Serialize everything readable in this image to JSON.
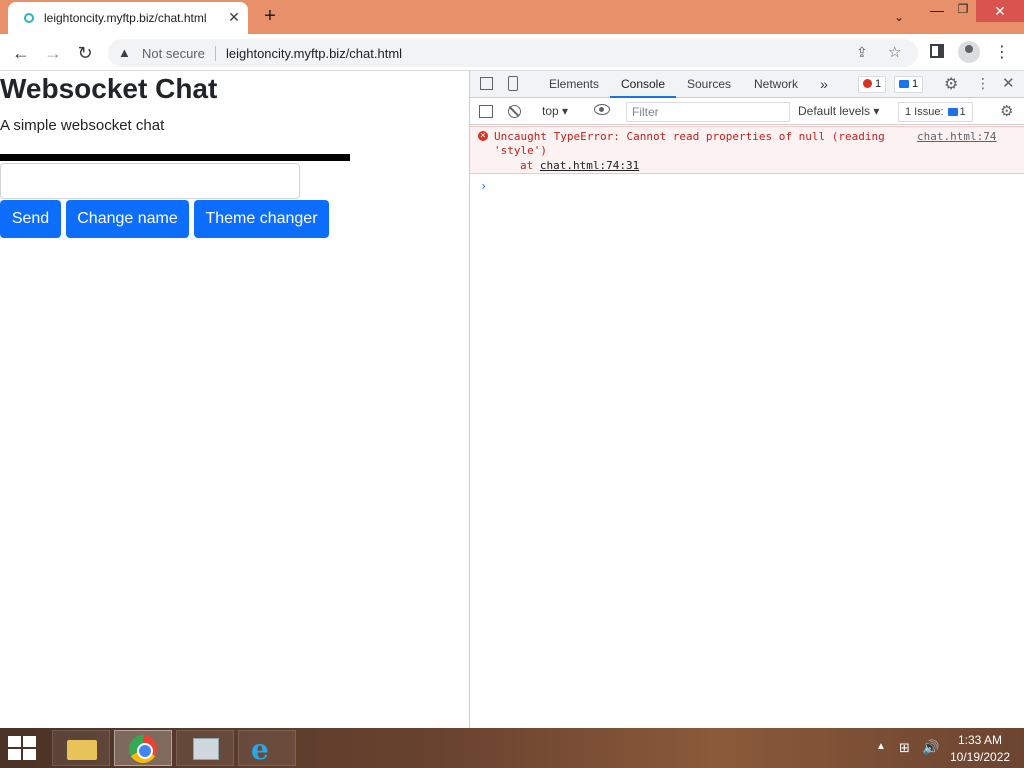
{
  "browser": {
    "tab": {
      "title": "leightoncity.myftp.biz/chat.html",
      "close_glyph": "✕"
    },
    "new_tab_glyph": "+",
    "tab_search_glyph": "⌄",
    "window_controls": {
      "minimize": "—",
      "maximize": "❐",
      "close": "✕"
    },
    "nav": {
      "back": "←",
      "forward": "→",
      "reload": "↻"
    },
    "omnibox": {
      "security_label": "Not secure",
      "url": "leightoncity.myftp.biz/chat.html",
      "warning_glyph": "▲"
    },
    "toolbar_glyphs": {
      "share": "⇪",
      "star": "☆",
      "menu": "⋮"
    }
  },
  "page": {
    "title": "Websocket Chat",
    "subtitle": "A simple websocket chat",
    "message_input": {
      "value": "",
      "placeholder": ""
    },
    "buttons": {
      "send": "Send",
      "change_name": "Change name",
      "theme_changer": "Theme changer"
    },
    "colors": {
      "button_bg": "#0d6efd",
      "chat_box": "#000000"
    }
  },
  "devtools": {
    "tabs": [
      "Elements",
      "Console",
      "Sources",
      "Network"
    ],
    "active_tab": "Console",
    "more_tabs_glyph": "»",
    "error_count": "1",
    "message_count": "1",
    "glyphs": {
      "settings": "⚙",
      "more": "⋮",
      "close": "✕"
    },
    "filter_bar": {
      "context": "top ▾",
      "filter_placeholder": "Filter",
      "levels": "Default levels ▾",
      "issues_label": "1 Issue:",
      "issues_count": "1"
    },
    "console": {
      "error_message": "Uncaught TypeError: Cannot read properties of null (reading 'style')",
      "error_source": "chat.html:74",
      "stack_prefix": "at ",
      "stack_link": "chat.html:74:31",
      "prompt_glyph": "›"
    },
    "colors": {
      "error_text": "#c5221f",
      "error_row_bg": "#fdf2f2",
      "active_tab_underline": "#1a73e8"
    }
  },
  "taskbar": {
    "apps": [
      "file-explorer",
      "google-chrome",
      "performance-monitor",
      "internet-explorer"
    ],
    "active_app": "google-chrome",
    "ie_glyph": "e",
    "tray": {
      "up_glyph": "▲",
      "network_glyph": "⊞",
      "volume_glyph": "🔊"
    },
    "clock": {
      "time": "1:33 AM",
      "date": "10/19/2022"
    }
  }
}
